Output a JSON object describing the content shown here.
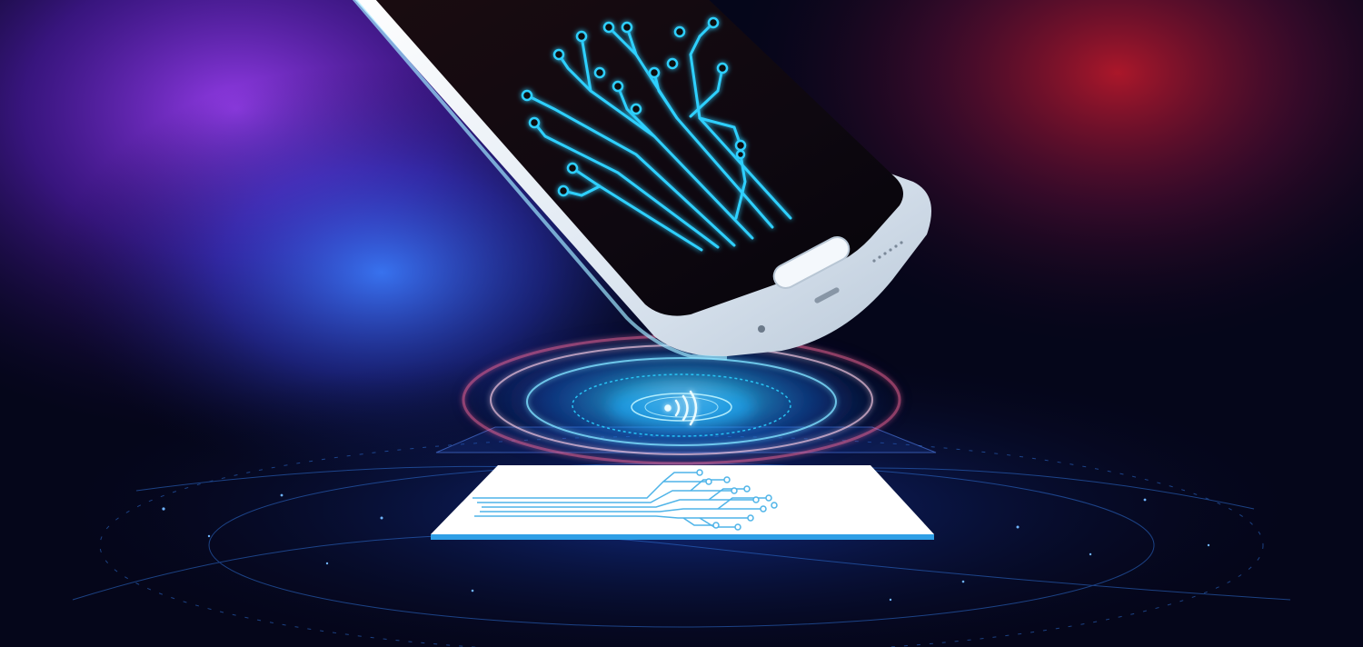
{
  "scene": {
    "subject": "smartphone-nfc-card",
    "palette": {
      "background": "#05061a",
      "purple_glow": "#7a2bd6",
      "red_glow": "#b01830",
      "electric_blue": "#1fa8ff",
      "circuit_cyan": "#2fd0ff",
      "card_white": "#ffffff",
      "card_circuit": "#4fb4e8",
      "phone_body": "#eef3f8"
    }
  }
}
